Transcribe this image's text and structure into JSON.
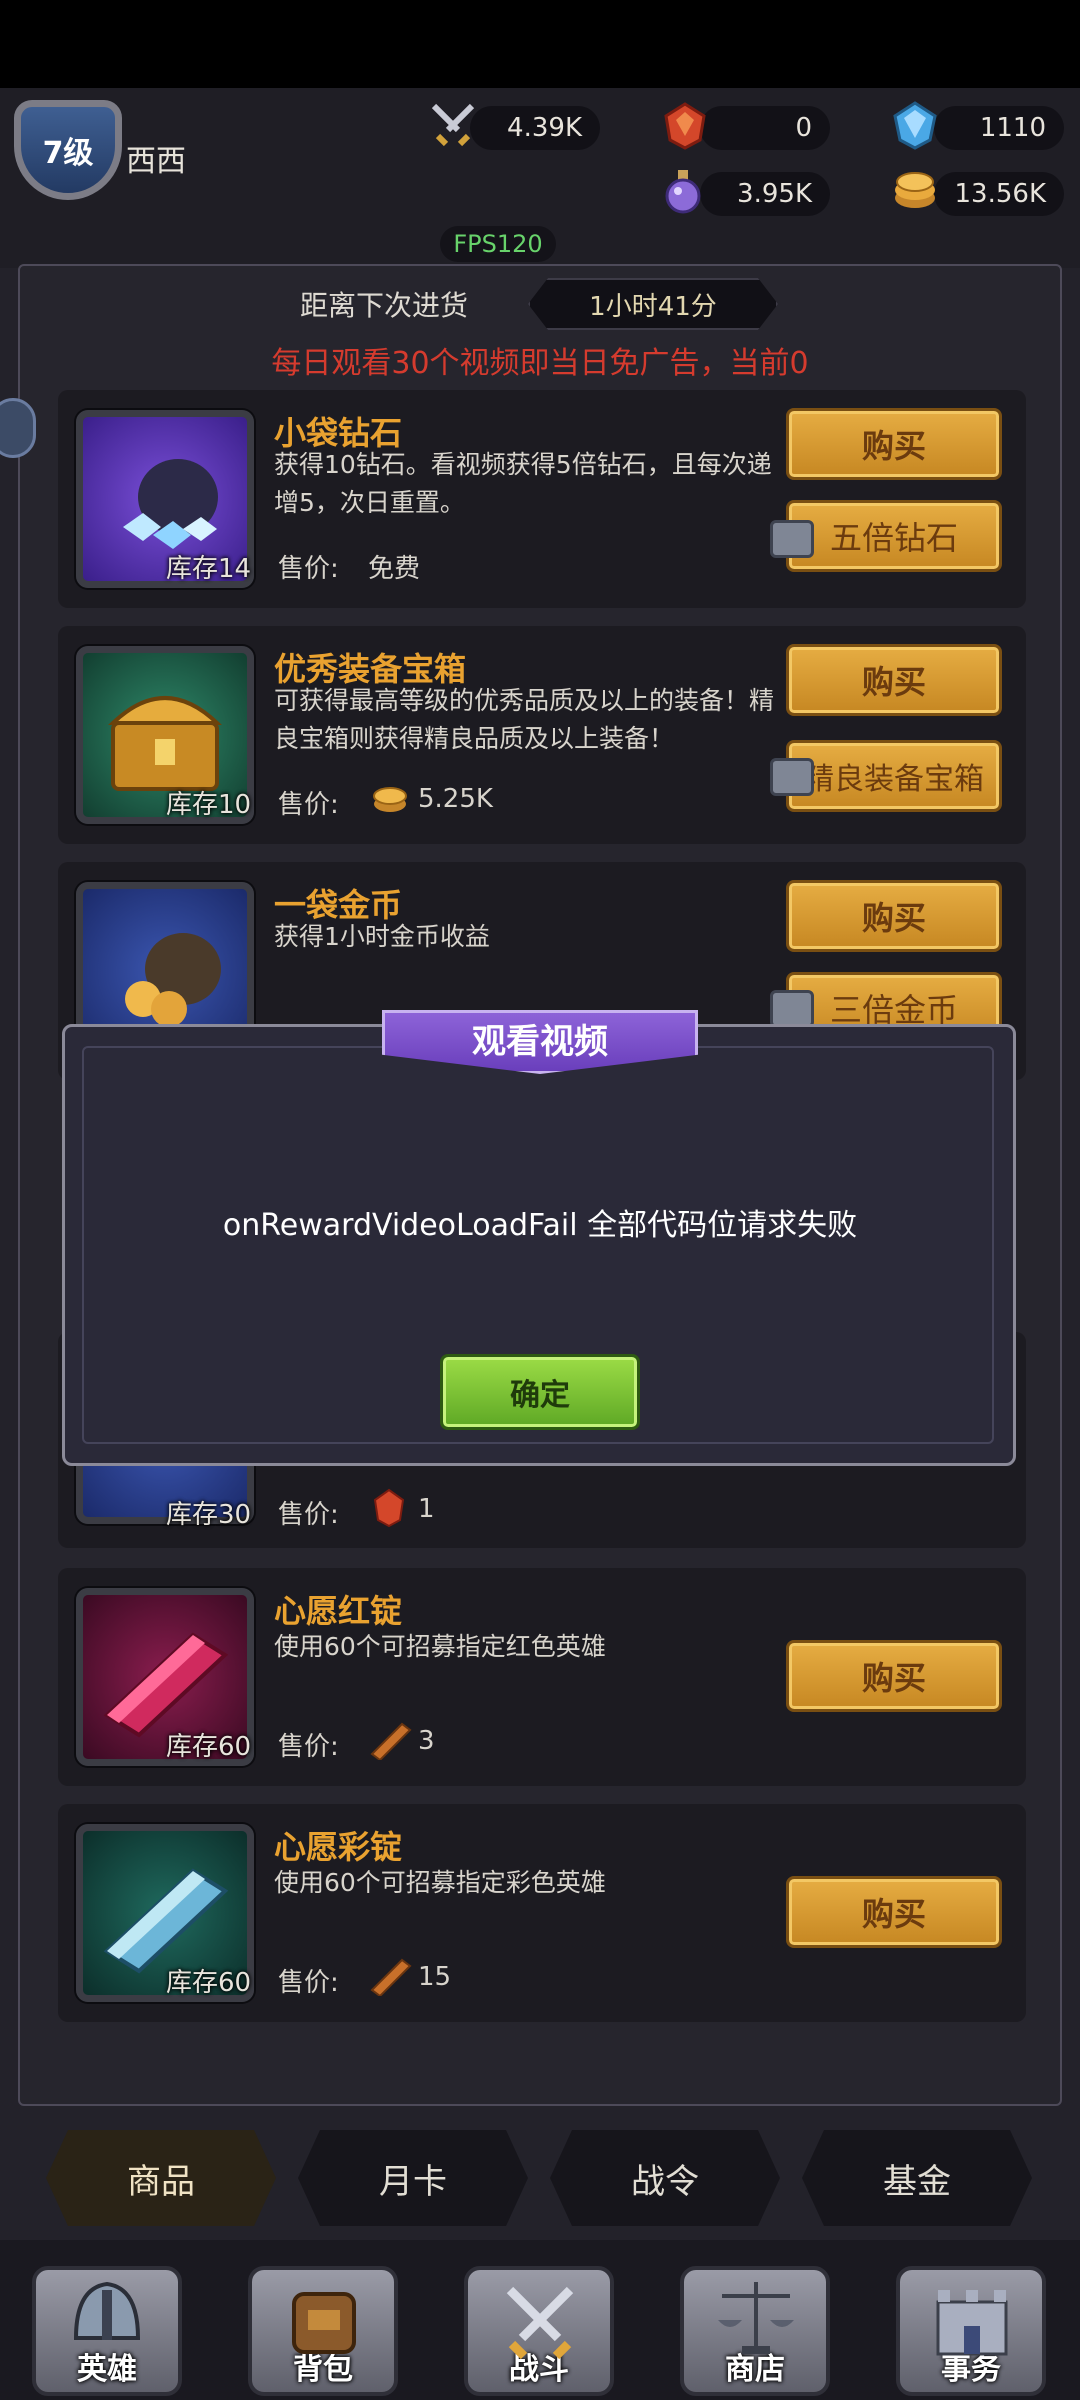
{
  "header": {
    "level": "7级",
    "username": "西西",
    "resources": {
      "power": "4.39K",
      "ruby": "0",
      "diamond": "1110",
      "potion": "3.95K",
      "gold": "13.56K"
    },
    "fps": "FPS120"
  },
  "shop": {
    "restock_label": "距离下次进货",
    "restock_time": "1小时41分",
    "notice": "每日观看30个视频即当日免广告，当前0",
    "items": [
      {
        "title": "小袋钻石",
        "desc": "获得10钻石。看视频获得5倍钻石，且每次递增5，次日重置。",
        "stock": "库存14",
        "price_label": "售价:",
        "price": "免费",
        "buy": "购买",
        "video_btn": "五倍钻石"
      },
      {
        "title": "优秀装备宝箱",
        "desc": "可获得最高等级的优秀品质及以上的装备！精良宝箱则获得精良品质及以上装备！",
        "stock": "库存10",
        "price_label": "售价:",
        "price": "5.25K",
        "buy": "购买",
        "video_btn": "精良装备宝箱"
      },
      {
        "title": "一袋金币",
        "desc": "获得1小时金币收益",
        "buy": "购买",
        "video_btn": "三倍金币"
      },
      {
        "stock": "库存30",
        "price_label": "售价:",
        "price": "1"
      },
      {
        "title": "心愿红锭",
        "desc": "使用60个可招募指定红色英雄",
        "stock": "库存60",
        "price_label": "售价:",
        "price": "3",
        "buy": "购买"
      },
      {
        "title": "心愿彩锭",
        "desc": "使用60个可招募指定彩色英雄",
        "stock": "库存60",
        "price_label": "售价:",
        "price": "15",
        "buy": "购买"
      }
    ]
  },
  "dialog": {
    "title": "观看视频",
    "message": "onRewardVideoLoadFail 全部代码位请求失败",
    "confirm": "确定"
  },
  "subtabs": [
    "商品",
    "月卡",
    "战令",
    "基金"
  ],
  "bottom_nav": [
    "英雄",
    "背包",
    "战斗",
    "商店",
    "事务"
  ],
  "colors": {
    "accent_gold": "#e6ad43",
    "title_orange": "#e9a230",
    "notice_red": "#d53b2e",
    "fps_green": "#68d36b",
    "dialog_purple": "#7b50cc",
    "confirm_green": "#7cc436"
  }
}
